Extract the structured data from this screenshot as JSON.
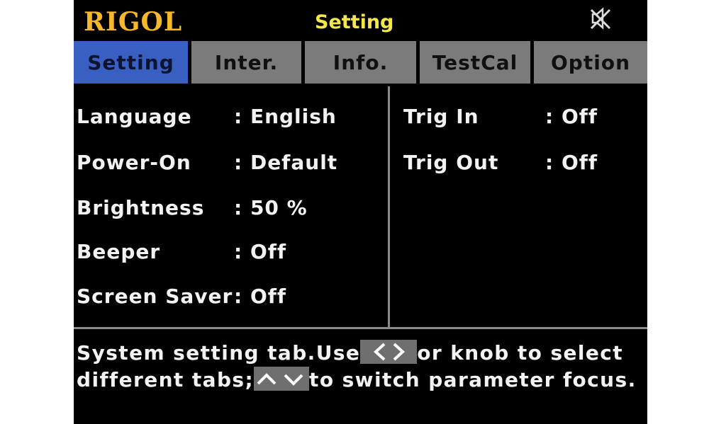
{
  "header": {
    "logo": "RIGOL",
    "title": "Setting",
    "icon": "mute-icon"
  },
  "tabs": [
    {
      "label": "Setting",
      "active": true
    },
    {
      "label": "Inter."
    },
    {
      "label": "Info."
    },
    {
      "label": "TestCal"
    },
    {
      "label": "Option"
    }
  ],
  "left_params": [
    {
      "label": "Language",
      "value": ": English"
    },
    {
      "label": "Power-On",
      "value": ": Default"
    },
    {
      "label": "Brightness",
      "value": ": 50 %"
    },
    {
      "label": "Beeper",
      "value": ": Off"
    },
    {
      "label": "Screen Saver",
      "value": ": Off"
    }
  ],
  "right_params": [
    {
      "label": "Trig In",
      "value": ": Off"
    },
    {
      "label": "Trig Out",
      "value": ": Off"
    }
  ],
  "help": {
    "line1_a": "System setting tab.Use",
    "line1_b": "or knob to select",
    "line2_a": "different tabs;",
    "line2_b": "to switch parameter focus.",
    "key_lr_icon": "left-right-arrows-icon",
    "key_ud_icon": "up-down-arrows-icon"
  },
  "colors": {
    "logo": "#f5b82a",
    "title": "#f4e64b",
    "active_tab": "#3a5fc2",
    "inactive_tab": "#7b7b7b"
  }
}
